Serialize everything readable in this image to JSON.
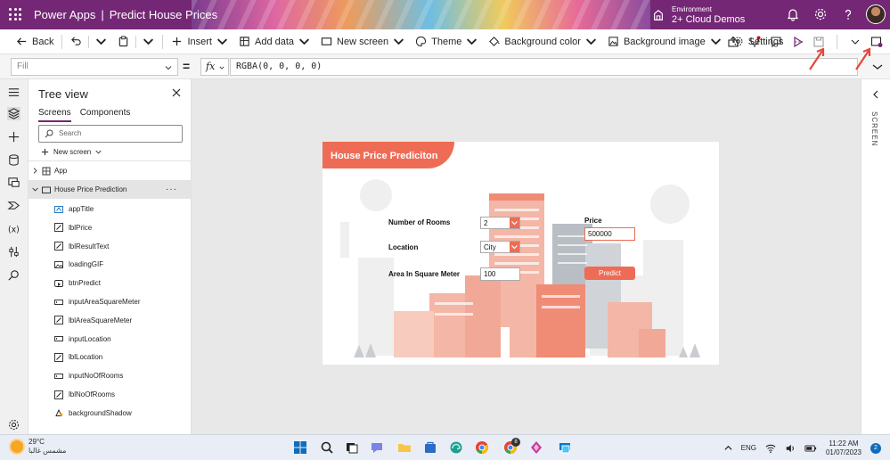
{
  "titlebar": {
    "product": "Power Apps",
    "separator": "|",
    "app_name": "Predict House Prices",
    "environment_label": "Environment",
    "environment_value": "2+ Cloud Demos"
  },
  "commandbar": {
    "back": "Back",
    "insert": "Insert",
    "add_data": "Add data",
    "new_screen": "New screen",
    "theme": "Theme",
    "background_color": "Background color",
    "background_image": "Background image",
    "settings": "Settings",
    "more": "···"
  },
  "formulabar": {
    "property": "Fill",
    "equals": "=",
    "fx": "fx",
    "formula": "RGBA(0, 0, 0, 0)"
  },
  "tree": {
    "title": "Tree view",
    "tabs": [
      "Screens",
      "Components"
    ],
    "search_placeholder": "Search",
    "new_screen": "New screen",
    "app_item": "App",
    "screen_item": "House Price Prediction",
    "more": "···",
    "controls": [
      {
        "name": "appTitle",
        "icon": "label-icon"
      },
      {
        "name": "lblPrice",
        "icon": "edit-label-icon"
      },
      {
        "name": "lblResultText",
        "icon": "edit-label-icon"
      },
      {
        "name": "loadingGIF",
        "icon": "image-icon"
      },
      {
        "name": "btnPredict",
        "icon": "button-icon"
      },
      {
        "name": "inputAreaSquareMeter",
        "icon": "textinput-icon"
      },
      {
        "name": "lblAreaSquareMeter",
        "icon": "edit-label-icon"
      },
      {
        "name": "inputLocation",
        "icon": "textinput-icon"
      },
      {
        "name": "lblLocation",
        "icon": "edit-label-icon"
      },
      {
        "name": "inputNoOfRooms",
        "icon": "textinput-icon"
      },
      {
        "name": "lblNoOfRooms",
        "icon": "edit-label-icon"
      },
      {
        "name": "backgroundShadow",
        "icon": "shape-icon"
      }
    ]
  },
  "app": {
    "header": "House Price Prediciton",
    "rooms_label": "Number of Rooms",
    "rooms_value": "2",
    "location_label": "Location",
    "location_value": "City",
    "area_label": "Area In Square Meter",
    "area_value": "100",
    "price_label": "Price",
    "price_value": "500000",
    "predict_button": "Predict"
  },
  "rightpanel": {
    "label": "SCREEN"
  },
  "taskbar": {
    "temperature": "29°C",
    "condition": "مشمس غالبا",
    "language": "ENG",
    "time": "11:22 AM",
    "date": "01/07/2023",
    "notifications": "2",
    "app_badge": "8"
  },
  "colors": {
    "accent": "#742774",
    "app_primary": "#ee6c55"
  }
}
